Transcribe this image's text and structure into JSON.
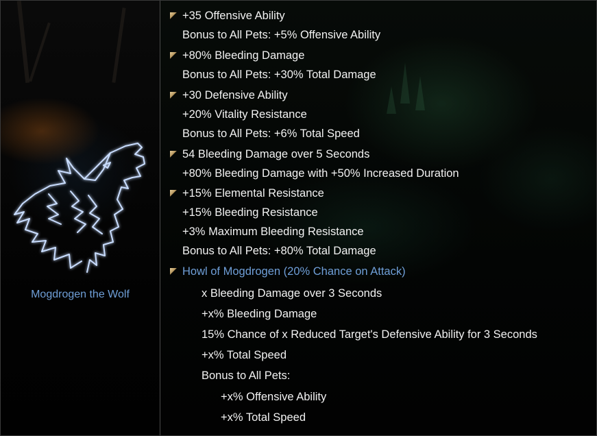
{
  "constellation": {
    "name": "Mogdrogen the Wolf",
    "icon": "howling-wolf-icon"
  },
  "colors": {
    "stat_text": "#f2f2f2",
    "skill_link": "#6f9fd8",
    "bullet": "#c9ad75",
    "divider": "#4a4a4a"
  },
  "stars": [
    {
      "bonus": "+35 Offensive Ability",
      "lines": [
        "Bonus to All Pets: +5% Offensive Ability"
      ]
    },
    {
      "bonus": "+80% Bleeding Damage",
      "lines": [
        "Bonus to All Pets: +30% Total Damage"
      ]
    },
    {
      "bonus": "+30 Defensive Ability",
      "lines": [
        "+20% Vitality Resistance",
        "Bonus to All Pets: +6% Total Speed"
      ]
    },
    {
      "bonus": "54 Bleeding Damage over 5 Seconds",
      "lines": [
        "+80% Bleeding Damage with +50% Increased Duration"
      ]
    },
    {
      "bonus": "+15% Elemental Resistance",
      "lines": [
        "+15% Bleeding Resistance",
        "+3% Maximum Bleeding Resistance",
        "Bonus to All Pets: +80% Total Damage"
      ]
    }
  ],
  "celestial_power": {
    "name": "Howl of Mogdrogen (20% Chance on Attack)",
    "effects": [
      "x Bleeding Damage over 3 Seconds",
      "+x% Bleeding Damage",
      "15% Chance of x Reduced Target's Defensive Ability for 3 Seconds",
      "+x% Total Speed",
      "Bonus to All Pets:"
    ],
    "pet_effects": [
      "+x% Offensive Ability",
      "+x% Total Speed"
    ]
  }
}
